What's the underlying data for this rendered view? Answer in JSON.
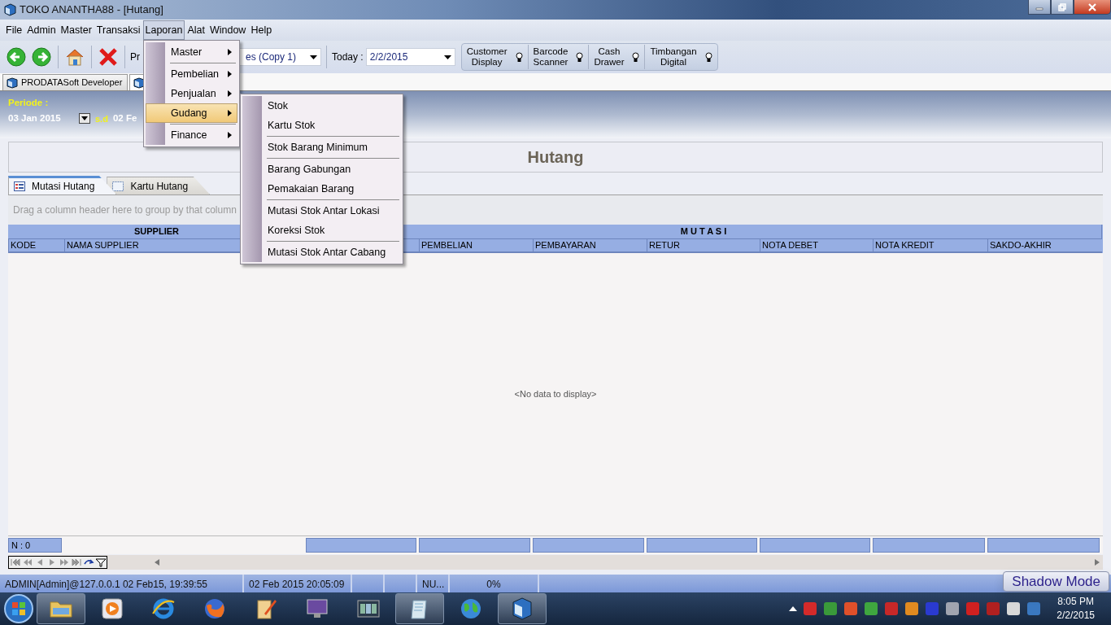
{
  "window": {
    "title": "TOKO ANANTHA88 - [Hutang]"
  },
  "menu_bar": [
    {
      "label": "File",
      "selected": false
    },
    {
      "label": "Admin",
      "selected": false
    },
    {
      "label": "Master",
      "selected": false
    },
    {
      "label": "Transaksi",
      "selected": false
    },
    {
      "label": "Laporan",
      "selected": true
    },
    {
      "label": "Alat",
      "selected": false
    },
    {
      "label": "Window",
      "selected": false
    },
    {
      "label": "Help",
      "selected": false
    }
  ],
  "laporan_menu": [
    {
      "label": "Master",
      "selected": false,
      "has_submenu": true,
      "separator_after": true
    },
    {
      "label": "Pembelian",
      "selected": false,
      "has_submenu": true,
      "separator_after": false
    },
    {
      "label": "Penjualan",
      "selected": false,
      "has_submenu": true,
      "separator_after": false
    },
    {
      "label": "Gudang",
      "selected": true,
      "has_submenu": true,
      "separator_after": true
    },
    {
      "label": "Finance",
      "selected": false,
      "has_submenu": true,
      "separator_after": false
    }
  ],
  "gudang_submenu": [
    {
      "label": "Stok",
      "selected": false,
      "separator_after": false
    },
    {
      "label": "Kartu Stok",
      "selected": false,
      "separator_after": true
    },
    {
      "label": "Stok Barang Minimum",
      "selected": false,
      "separator_after": true
    },
    {
      "label": "Barang Gabungan",
      "selected": false,
      "separator_after": false
    },
    {
      "label": "Pemakaian Barang",
      "selected": false,
      "separator_after": true
    },
    {
      "label": "Mutasi Stok Antar Lokasi",
      "selected": false,
      "separator_after": false
    },
    {
      "label": "Koreksi Stok",
      "selected": false,
      "separator_after": true
    },
    {
      "label": "Mutasi Stok Antar Cabang",
      "selected": false,
      "separator_after": false
    }
  ],
  "toolbar": {
    "partial_label": "Pr",
    "profile_combo": {
      "value": "es (Copy 1)"
    },
    "today_label": "Today :",
    "today_combo": {
      "value": "2/2/2015"
    },
    "devices": [
      {
        "lines": [
          "Customer",
          "Display"
        ]
      },
      {
        "lines": [
          "Barcode",
          "Scanner"
        ]
      },
      {
        "lines": [
          "Cash",
          "Drawer"
        ]
      },
      {
        "lines": [
          "Timbangan",
          "Digital"
        ]
      }
    ]
  },
  "document_tabs": [
    {
      "label": "PRODATASoft Developer",
      "selected": false
    },
    {
      "selected": true
    }
  ],
  "period": {
    "label": "Periode :",
    "from": "03 Jan 2015",
    "to_label": "s.d",
    "to": "02 Fe"
  },
  "panel_title": "Hutang",
  "tabs": [
    {
      "label": "Mutasi Hutang",
      "selected": true
    },
    {
      "label": "Kartu Hutang",
      "selected": false
    }
  ],
  "group_hint": "Drag a column header here to group by that column",
  "grid": {
    "bands": [
      {
        "label": "SUPPLIER",
        "columns": [
          {
            "label": "KODE"
          },
          {
            "label": "NAMA SUPPLIER"
          }
        ]
      },
      {
        "label": "M U T A S I",
        "columns": [
          {},
          {
            "label": "PEMBELIAN"
          },
          {
            "label": "PEMBAYARAN"
          },
          {
            "label": "RETUR"
          },
          {
            "label": "NOTA DEBET"
          },
          {
            "label": "NOTA KREDIT"
          },
          {
            "label": "SAKDO-AKHIR"
          }
        ]
      }
    ],
    "empty_text": "<No data to display>",
    "count": "N : 0"
  },
  "status_bar": {
    "cells": [
      {
        "text": "ADMIN[Admin]@127.0.0.1 02 Feb15, 19:39:55"
      },
      {
        "text": "02 Feb 2015 20:05:09"
      },
      {},
      {},
      {
        "text": "NU..."
      },
      {
        "text": "0%"
      }
    ],
    "shadow_mode": "Shadow Mode"
  },
  "taskbar": {
    "apps": [
      {
        "kind": "folder",
        "active": true
      },
      {
        "kind": "media",
        "active": false
      },
      {
        "kind": "ie",
        "active": false
      },
      {
        "kind": "firefox",
        "active": false
      },
      {
        "kind": "editor",
        "active": false
      },
      {
        "kind": "monitor",
        "active": false
      },
      {
        "kind": "windows",
        "active": false
      },
      {
        "kind": "notepad",
        "active": true
      },
      {
        "kind": "globe",
        "active": false
      },
      {
        "kind": "app",
        "active": true
      }
    ],
    "tray": [
      {
        "color": "#d42a2a"
      },
      {
        "color": "#3a9a3a"
      },
      {
        "color": "#e0502a"
      },
      {
        "color": "#3fa63f"
      },
      {
        "color": "#c82828"
      },
      {
        "color": "#e08a20"
      },
      {
        "color": "#2a3ad0"
      },
      {
        "color": "#a0a4b0"
      },
      {
        "color": "#d02020"
      },
      {
        "color": "#b02020"
      },
      {
        "color": "#d8d8d8"
      },
      {
        "color": "#3a78c0"
      }
    ],
    "time": "8:05 PM",
    "date": "2/2/2015"
  }
}
